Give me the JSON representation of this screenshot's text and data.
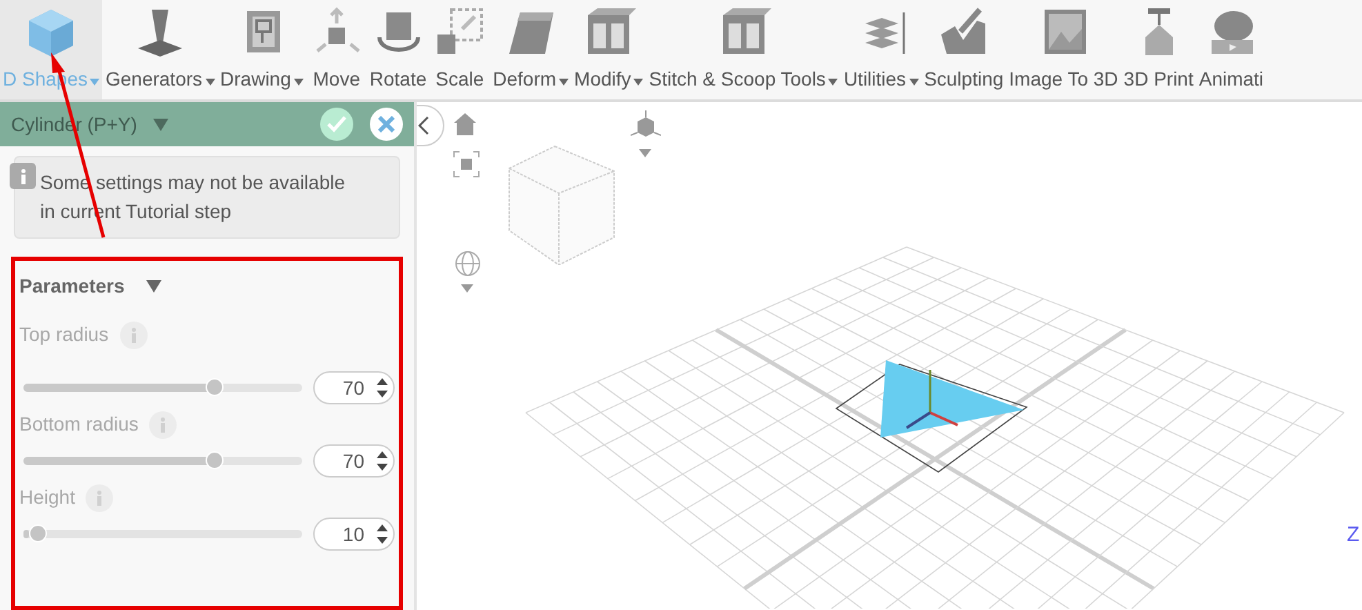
{
  "toolbar": [
    {
      "label": "D Shapes",
      "kind": "cube",
      "dropdown": true,
      "selected": true
    },
    {
      "label": "Generators",
      "kind": "stamp",
      "dropdown": true,
      "selected": false
    },
    {
      "label": "Drawing",
      "kind": "drawing",
      "dropdown": true,
      "selected": false
    },
    {
      "label": "Move",
      "kind": "move",
      "dropdown": false,
      "selected": false
    },
    {
      "label": "Rotate",
      "kind": "rotate",
      "dropdown": false,
      "selected": false
    },
    {
      "label": "Scale",
      "kind": "scale",
      "dropdown": false,
      "selected": false
    },
    {
      "label": "Deform",
      "kind": "deform",
      "dropdown": true,
      "selected": false
    },
    {
      "label": "Modify",
      "kind": "modify",
      "dropdown": true,
      "selected": false
    },
    {
      "label": "Stitch & Scoop Tools",
      "kind": "stitch",
      "dropdown": true,
      "selected": false
    },
    {
      "label": "Utilities",
      "kind": "layers",
      "dropdown": true,
      "selected": false
    },
    {
      "label": "Sculpting",
      "kind": "sculpt",
      "dropdown": false,
      "selected": false
    },
    {
      "label": "Image To 3D",
      "kind": "image",
      "dropdown": false,
      "selected": false
    },
    {
      "label": "3D Print",
      "kind": "print",
      "dropdown": false,
      "selected": false
    },
    {
      "label": "Animati",
      "kind": "animation",
      "dropdown": false,
      "selected": false
    }
  ],
  "panel": {
    "title": "Cylinder (P+Y)",
    "notice": "Some settings may not be available in current Tutorial step",
    "section": "Parameters",
    "parameters": [
      {
        "label": "Top radius",
        "disabled": true,
        "level": 0.7,
        "value": "70"
      },
      {
        "label": "Bottom radius",
        "disabled": true,
        "level": 0.7,
        "value": "70"
      },
      {
        "label": "Height",
        "disabled": true,
        "level": 0.02,
        "value": "10"
      }
    ]
  },
  "viewport": {
    "axis_label": "Z"
  }
}
